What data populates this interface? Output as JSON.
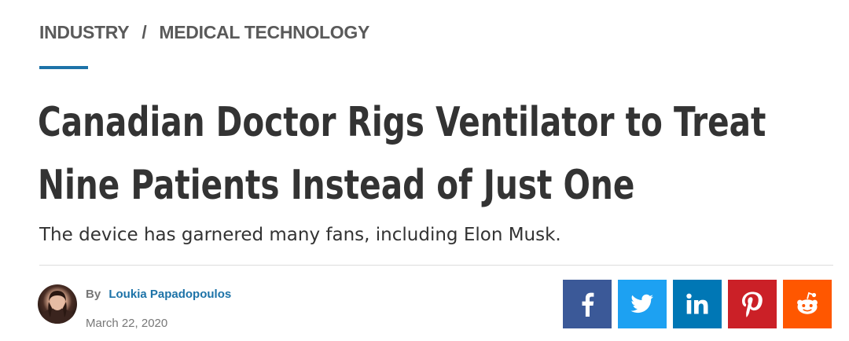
{
  "breadcrumb": {
    "items": [
      {
        "label": "INDUSTRY"
      },
      {
        "label": "MEDICAL TECHNOLOGY"
      }
    ],
    "separator": "/"
  },
  "article": {
    "headline_lines": [
      "Canadian Doctor Rigs Ventilator to Treat",
      "Nine Patients Instead of Just One"
    ],
    "subtitle": "The device has garnered many fans, including Elon Musk.",
    "byline_prefix": "By",
    "author": "Loukia Papadopoulos",
    "date": "March 22, 2020"
  },
  "share": {
    "buttons": [
      {
        "network": "facebook",
        "icon": "facebook-icon",
        "color": "#3b5998"
      },
      {
        "network": "twitter",
        "icon": "twitter-icon",
        "color": "#1da1f2"
      },
      {
        "network": "linkedin",
        "icon": "linkedin-icon",
        "color": "#0077b5"
      },
      {
        "network": "pinterest",
        "icon": "pinterest-icon",
        "color": "#cb2027"
      },
      {
        "network": "reddit",
        "icon": "reddit-icon",
        "color": "#ff5700"
      }
    ]
  },
  "colors": {
    "accent": "#1d73a8",
    "text": "#333333",
    "muted": "#777777"
  }
}
